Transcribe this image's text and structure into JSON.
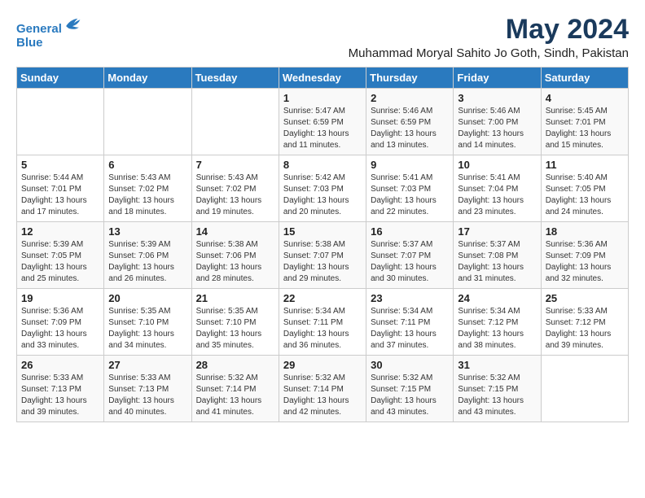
{
  "header": {
    "logo_line1": "General",
    "logo_line2": "Blue",
    "main_title": "May 2024",
    "subtitle": "Muhammad Moryal Sahito Jo Goth, Sindh, Pakistan"
  },
  "calendar": {
    "days_of_week": [
      "Sunday",
      "Monday",
      "Tuesday",
      "Wednesday",
      "Thursday",
      "Friday",
      "Saturday"
    ],
    "weeks": [
      [
        {
          "day": "",
          "content": ""
        },
        {
          "day": "",
          "content": ""
        },
        {
          "day": "",
          "content": ""
        },
        {
          "day": "1",
          "content": "Sunrise: 5:47 AM\nSunset: 6:59 PM\nDaylight: 13 hours\nand 11 minutes."
        },
        {
          "day": "2",
          "content": "Sunrise: 5:46 AM\nSunset: 6:59 PM\nDaylight: 13 hours\nand 13 minutes."
        },
        {
          "day": "3",
          "content": "Sunrise: 5:46 AM\nSunset: 7:00 PM\nDaylight: 13 hours\nand 14 minutes."
        },
        {
          "day": "4",
          "content": "Sunrise: 5:45 AM\nSunset: 7:01 PM\nDaylight: 13 hours\nand 15 minutes."
        }
      ],
      [
        {
          "day": "5",
          "content": "Sunrise: 5:44 AM\nSunset: 7:01 PM\nDaylight: 13 hours\nand 17 minutes."
        },
        {
          "day": "6",
          "content": "Sunrise: 5:43 AM\nSunset: 7:02 PM\nDaylight: 13 hours\nand 18 minutes."
        },
        {
          "day": "7",
          "content": "Sunrise: 5:43 AM\nSunset: 7:02 PM\nDaylight: 13 hours\nand 19 minutes."
        },
        {
          "day": "8",
          "content": "Sunrise: 5:42 AM\nSunset: 7:03 PM\nDaylight: 13 hours\nand 20 minutes."
        },
        {
          "day": "9",
          "content": "Sunrise: 5:41 AM\nSunset: 7:03 PM\nDaylight: 13 hours\nand 22 minutes."
        },
        {
          "day": "10",
          "content": "Sunrise: 5:41 AM\nSunset: 7:04 PM\nDaylight: 13 hours\nand 23 minutes."
        },
        {
          "day": "11",
          "content": "Sunrise: 5:40 AM\nSunset: 7:05 PM\nDaylight: 13 hours\nand 24 minutes."
        }
      ],
      [
        {
          "day": "12",
          "content": "Sunrise: 5:39 AM\nSunset: 7:05 PM\nDaylight: 13 hours\nand 25 minutes."
        },
        {
          "day": "13",
          "content": "Sunrise: 5:39 AM\nSunset: 7:06 PM\nDaylight: 13 hours\nand 26 minutes."
        },
        {
          "day": "14",
          "content": "Sunrise: 5:38 AM\nSunset: 7:06 PM\nDaylight: 13 hours\nand 28 minutes."
        },
        {
          "day": "15",
          "content": "Sunrise: 5:38 AM\nSunset: 7:07 PM\nDaylight: 13 hours\nand 29 minutes."
        },
        {
          "day": "16",
          "content": "Sunrise: 5:37 AM\nSunset: 7:07 PM\nDaylight: 13 hours\nand 30 minutes."
        },
        {
          "day": "17",
          "content": "Sunrise: 5:37 AM\nSunset: 7:08 PM\nDaylight: 13 hours\nand 31 minutes."
        },
        {
          "day": "18",
          "content": "Sunrise: 5:36 AM\nSunset: 7:09 PM\nDaylight: 13 hours\nand 32 minutes."
        }
      ],
      [
        {
          "day": "19",
          "content": "Sunrise: 5:36 AM\nSunset: 7:09 PM\nDaylight: 13 hours\nand 33 minutes."
        },
        {
          "day": "20",
          "content": "Sunrise: 5:35 AM\nSunset: 7:10 PM\nDaylight: 13 hours\nand 34 minutes."
        },
        {
          "day": "21",
          "content": "Sunrise: 5:35 AM\nSunset: 7:10 PM\nDaylight: 13 hours\nand 35 minutes."
        },
        {
          "day": "22",
          "content": "Sunrise: 5:34 AM\nSunset: 7:11 PM\nDaylight: 13 hours\nand 36 minutes."
        },
        {
          "day": "23",
          "content": "Sunrise: 5:34 AM\nSunset: 7:11 PM\nDaylight: 13 hours\nand 37 minutes."
        },
        {
          "day": "24",
          "content": "Sunrise: 5:34 AM\nSunset: 7:12 PM\nDaylight: 13 hours\nand 38 minutes."
        },
        {
          "day": "25",
          "content": "Sunrise: 5:33 AM\nSunset: 7:12 PM\nDaylight: 13 hours\nand 39 minutes."
        }
      ],
      [
        {
          "day": "26",
          "content": "Sunrise: 5:33 AM\nSunset: 7:13 PM\nDaylight: 13 hours\nand 39 minutes."
        },
        {
          "day": "27",
          "content": "Sunrise: 5:33 AM\nSunset: 7:13 PM\nDaylight: 13 hours\nand 40 minutes."
        },
        {
          "day": "28",
          "content": "Sunrise: 5:32 AM\nSunset: 7:14 PM\nDaylight: 13 hours\nand 41 minutes."
        },
        {
          "day": "29",
          "content": "Sunrise: 5:32 AM\nSunset: 7:14 PM\nDaylight: 13 hours\nand 42 minutes."
        },
        {
          "day": "30",
          "content": "Sunrise: 5:32 AM\nSunset: 7:15 PM\nDaylight: 13 hours\nand 43 minutes."
        },
        {
          "day": "31",
          "content": "Sunrise: 5:32 AM\nSunset: 7:15 PM\nDaylight: 13 hours\nand 43 minutes."
        },
        {
          "day": "",
          "content": ""
        }
      ]
    ]
  }
}
